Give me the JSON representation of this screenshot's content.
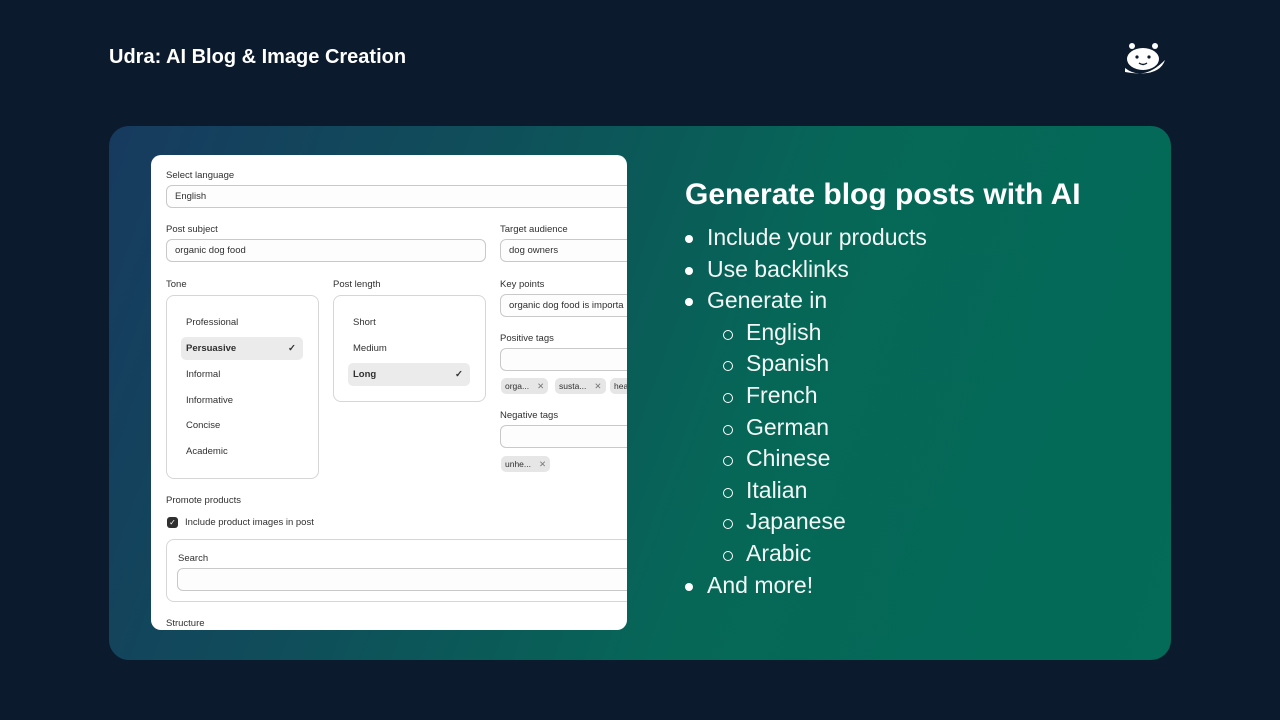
{
  "header": {
    "title": "Udra: AI Blog & Image Creation",
    "logo_icon": "otter-logo"
  },
  "form": {
    "language": {
      "label": "Select language",
      "value": "English"
    },
    "post_subject": {
      "label": "Post subject",
      "value": "organic dog food"
    },
    "target_audience": {
      "label": "Target audience",
      "value": "dog owners"
    },
    "tone": {
      "label": "Tone",
      "options": [
        "Professional",
        "Persuasive",
        "Informal",
        "Informative",
        "Concise",
        "Academic"
      ],
      "selected": "Persuasive"
    },
    "post_length": {
      "label": "Post length",
      "options": [
        "Short",
        "Medium",
        "Long"
      ],
      "selected": "Long"
    },
    "key_points": {
      "label": "Key points",
      "value": "organic dog food is importa"
    },
    "positive_tags": {
      "label": "Positive tags",
      "tags": [
        "orga...",
        "susta...",
        "hea"
      ]
    },
    "negative_tags": {
      "label": "Negative tags",
      "tags": [
        "unhe..."
      ]
    },
    "promote": {
      "label": "Promote products",
      "checkbox_label": "Include product images in post",
      "checked": true,
      "search_label": "Search"
    },
    "structure_label": "Structure"
  },
  "features": {
    "title": "Generate blog posts with AI",
    "items": [
      "Include your products",
      "Use backlinks",
      "Generate in"
    ],
    "languages": [
      "English",
      "Spanish",
      "French",
      "German",
      "Chinese",
      "Italian",
      "Japanese",
      "Arabic"
    ],
    "last": "And more!"
  }
}
